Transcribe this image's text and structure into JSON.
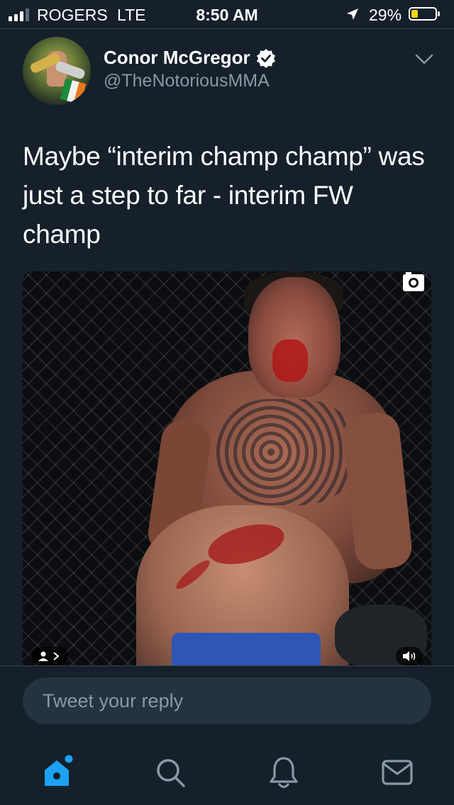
{
  "status_bar": {
    "carrier": "ROGERS",
    "network": "LTE",
    "time": "8:50 AM",
    "battery_percent": "29%",
    "battery_level": 0.29,
    "signal_bars_active": 3,
    "icons": [
      "signal-icon",
      "location-arrow-icon",
      "battery-icon"
    ]
  },
  "tweet": {
    "author": {
      "display_name": "Conor McGregor",
      "handle": "@TheNotoriousMMA",
      "verified": true
    },
    "text": "Maybe “interim champ champ” was just a step to far - interim FW champ",
    "media": {
      "type": "photo",
      "overlay_icons": [
        "camera-icon",
        "tag-people-icon",
        "sound-icon"
      ]
    }
  },
  "reply": {
    "placeholder": "Tweet your reply"
  },
  "tab_bar": {
    "items": [
      {
        "name": "home",
        "icon": "home-icon",
        "active": true,
        "has_notification_dot": true
      },
      {
        "name": "search",
        "icon": "search-icon",
        "active": false
      },
      {
        "name": "notifications",
        "icon": "bell-icon",
        "active": false
      },
      {
        "name": "messages",
        "icon": "mail-icon",
        "active": false
      }
    ]
  },
  "colors": {
    "background": "#15202b",
    "accent": "#1da1f2",
    "secondary_text": "#8899a6",
    "divider": "#38444d",
    "reply_field": "#253341",
    "battery_low": "#ffd60a"
  }
}
